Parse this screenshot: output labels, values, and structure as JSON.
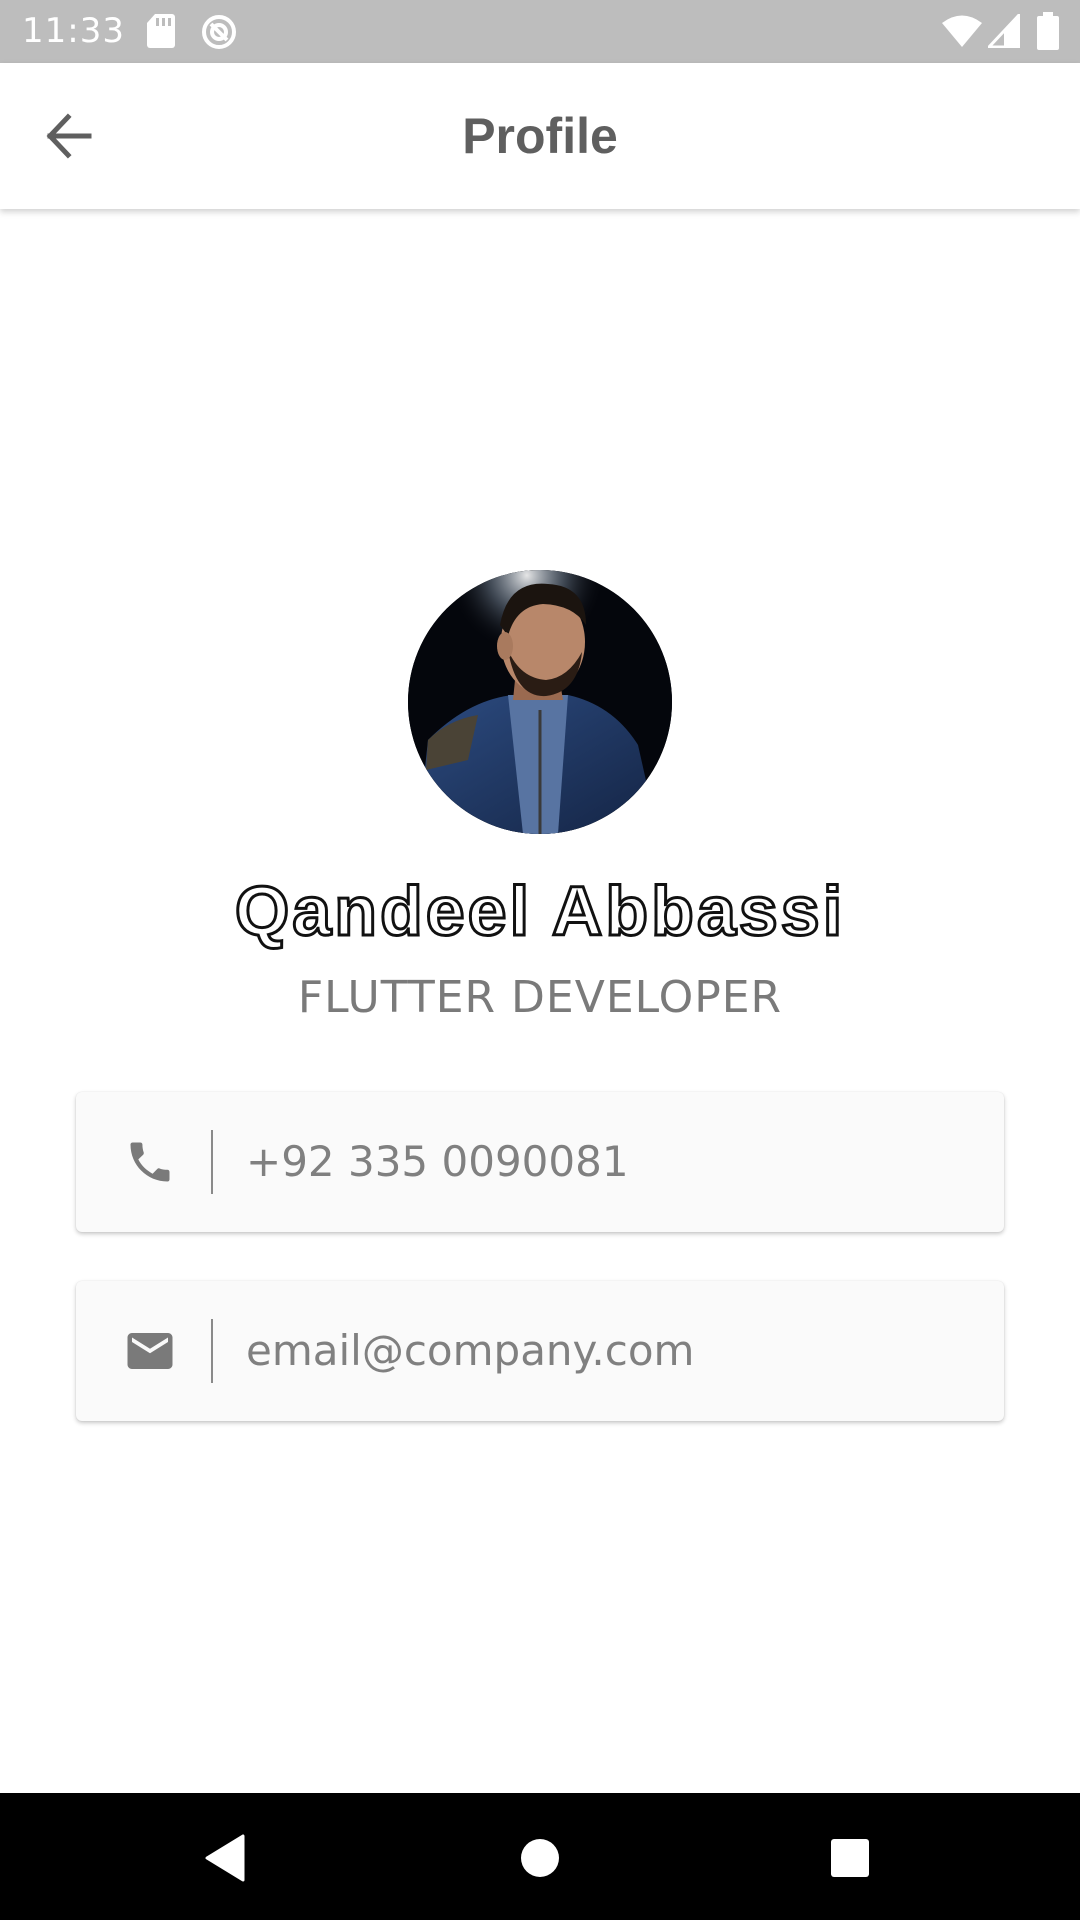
{
  "status_bar": {
    "time": "11:33",
    "icons": [
      "sd-card-icon",
      "sync-icon",
      "wifi-icon",
      "signal-icon",
      "battery-icon"
    ]
  },
  "app_bar": {
    "title": "Profile",
    "back_icon": "arrow-back-icon"
  },
  "profile": {
    "name": "Qandeel Abbassi",
    "role": "FLUTTER DEVELOPER"
  },
  "contacts": {
    "phone": {
      "icon": "phone-icon",
      "value": "+92 335 0090081"
    },
    "email": {
      "icon": "email-icon",
      "value": "email@company.com"
    }
  },
  "nav_bar": {
    "buttons": [
      "back-triangle-icon",
      "home-circle-icon",
      "recents-square-icon"
    ]
  },
  "colors": {
    "status_bar": "#bdbdbd",
    "app_bar": "#ffffff",
    "title_text": "#5f5f5f",
    "secondary_text": "#808080",
    "card_background": "#fafafa",
    "nav_bar": "#000000"
  }
}
